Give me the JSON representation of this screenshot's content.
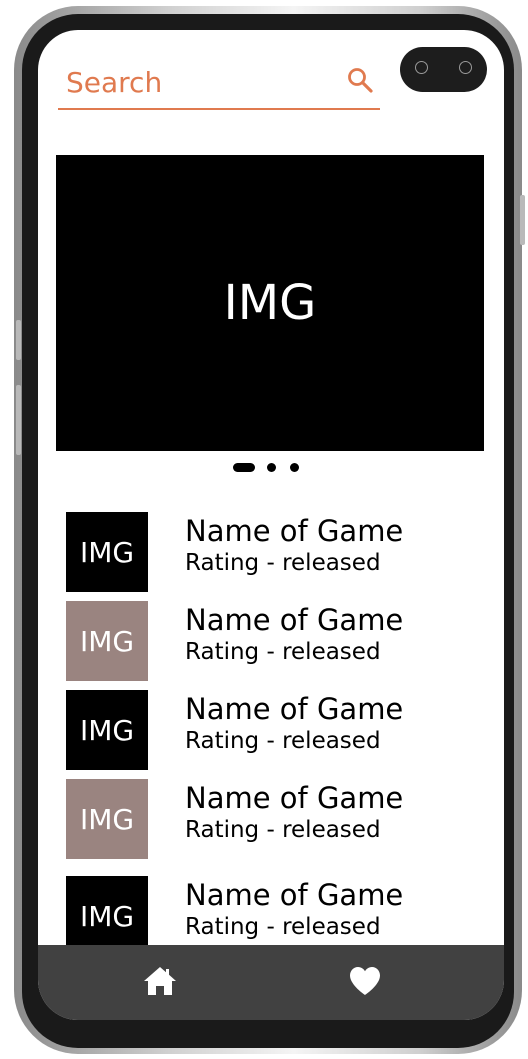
{
  "search": {
    "placeholder": "Search",
    "icon": "search-icon"
  },
  "hero": {
    "label": "IMG"
  },
  "carousel": {
    "count": 3,
    "active_index": 0
  },
  "games": [
    {
      "thumb_label": "IMG",
      "thumb_color": "#000000",
      "title": "Name of Game",
      "subtitle": "Rating - released"
    },
    {
      "thumb_label": "IMG",
      "thumb_color": "#9a8480",
      "title": "Name of Game",
      "subtitle": "Rating - released"
    },
    {
      "thumb_label": "IMG",
      "thumb_color": "#000000",
      "title": "Name of Game",
      "subtitle": "Rating - released"
    },
    {
      "thumb_label": "IMG",
      "thumb_color": "#9a8480",
      "title": "Name of Game",
      "subtitle": "Rating - released"
    },
    {
      "thumb_label": "IMG",
      "thumb_color": "#000000",
      "title": "Name of Game",
      "subtitle": "Rating - released"
    }
  ],
  "nav": {
    "items": [
      "home-icon",
      "heart-icon"
    ],
    "background": "#414141"
  },
  "colors": {
    "accent": "#e07a4f"
  }
}
